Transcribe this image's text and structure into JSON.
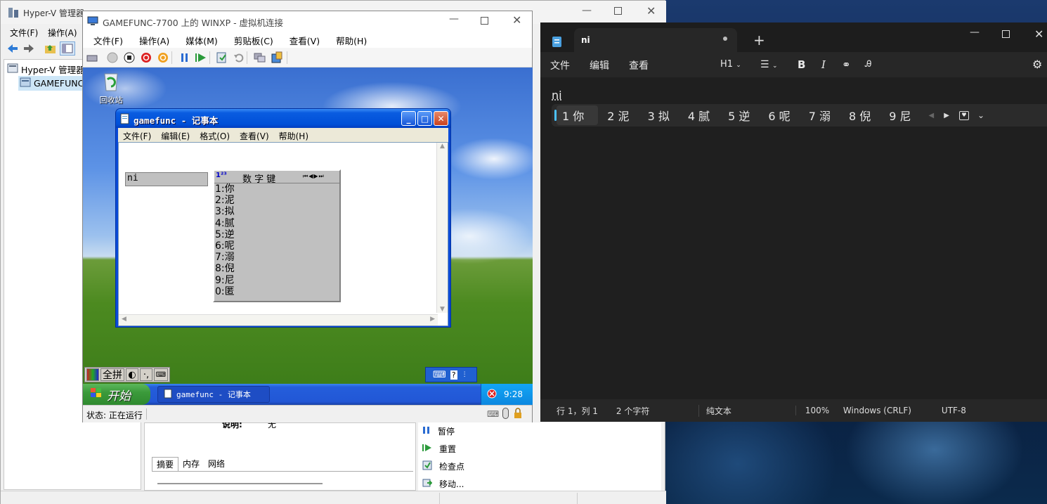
{
  "hyperv": {
    "title": "Hyper-V 管理器",
    "menu": [
      "文件(F)",
      "操作(A)"
    ],
    "tree": {
      "root": "Hyper-V 管理器",
      "child": "GAMEFUNC"
    },
    "details": {
      "desc_label": "说明:",
      "desc_value": "无"
    },
    "detail_tabs": [
      "摘要",
      "内存",
      "网络"
    ],
    "actions": [
      "暂停",
      "重置",
      "检查点",
      "移动..."
    ]
  },
  "vm": {
    "title": "GAMEFUNC-7700 上的 WINXP - 虚拟机连接",
    "menu": [
      "文件(F)",
      "操作(A)",
      "媒体(M)",
      "剪贴板(C)",
      "查看(V)",
      "帮助(H)"
    ],
    "status": "状态: 正在运行",
    "desktop": {
      "recycle_bin": "回收站"
    },
    "notepad": {
      "title": "gamefunc - 记事本",
      "menu": [
        "文件(F)",
        "编辑(E)",
        "格式(O)",
        "查看(V)",
        "帮助(H)"
      ],
      "ime_input": "ni",
      "ime_header_icon": "1²³",
      "ime_header": "数 字 键",
      "candidates": [
        "1:你",
        "2:泥",
        "3:拟",
        "4:腻",
        "5:逆",
        "6:呢",
        "7:溺",
        "8:倪",
        "9:尼",
        "0:匿"
      ]
    },
    "ime_toolbar": {
      "mode": "全拼"
    },
    "taskbar": {
      "start": "开始",
      "task": "gamefunc - 记事本",
      "clock": "9:28"
    }
  },
  "notepad11": {
    "tab_title": "ni",
    "menu": [
      "文件",
      "编辑",
      "查看"
    ],
    "heading_select": "H1",
    "text": "ni",
    "candidates": [
      "1 你",
      "2 泥",
      "3 拟",
      "4 腻",
      "5 逆",
      "6 呢",
      "7 溺",
      "8 倪",
      "9 尼"
    ],
    "status": {
      "position": "行 1，列 1",
      "chars": "2 个字符",
      "format": "纯文本",
      "zoom": "100%",
      "eol": "Windows (CRLF)",
      "encoding": "UTF-8"
    }
  },
  "colors": {
    "xp_title": "#0054e3",
    "xp_start": "#3b9a3b",
    "n11_bg": "#272727",
    "accent": "#4cc2ff"
  }
}
